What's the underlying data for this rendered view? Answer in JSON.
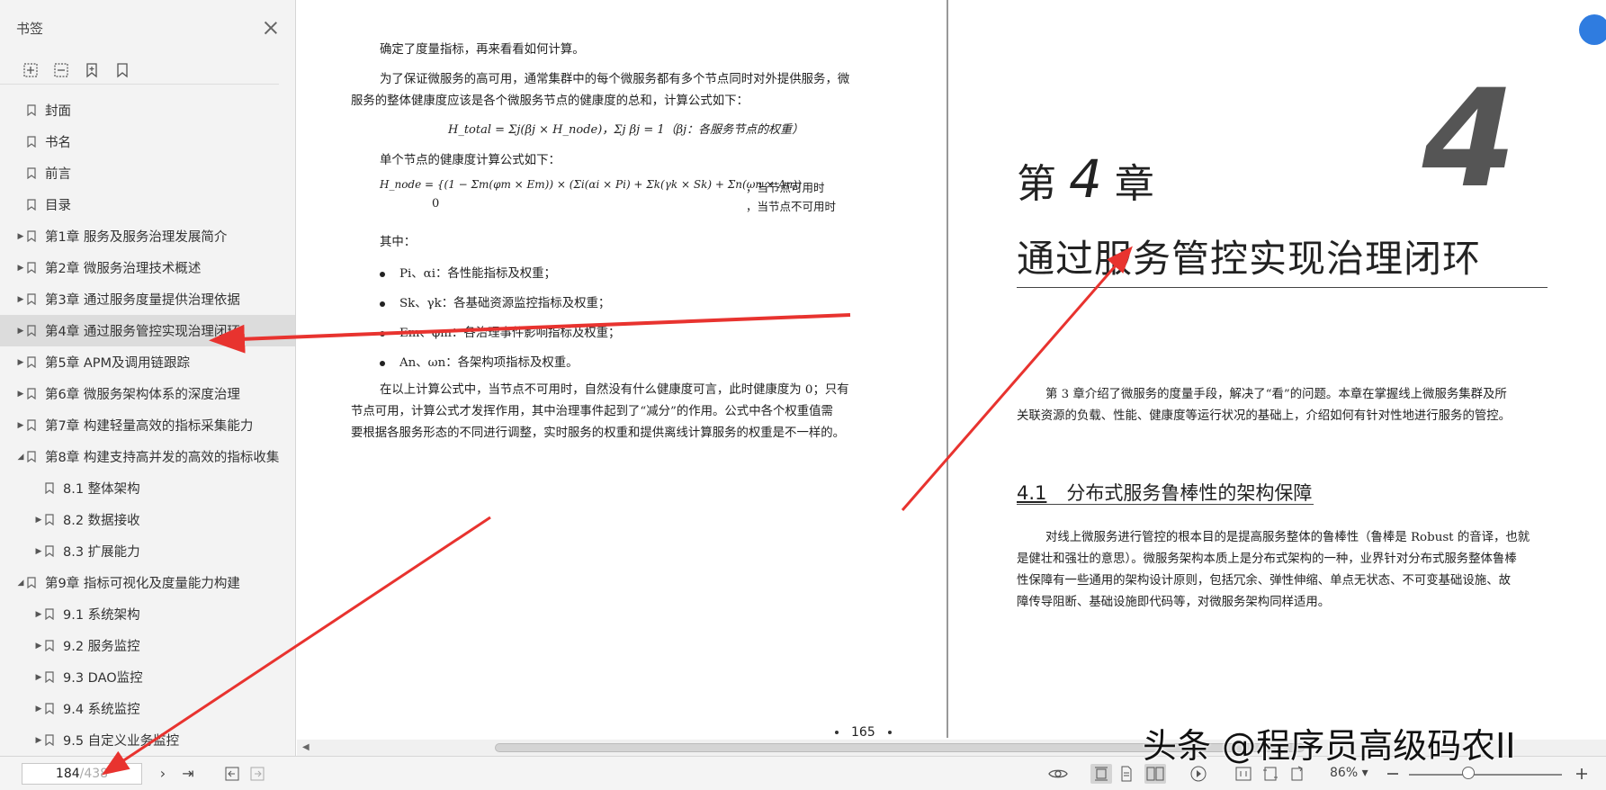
{
  "sidebar": {
    "title": "书签",
    "tools": [
      "expand-all-icon",
      "collapse-all-icon",
      "add-bookmark-icon",
      "bookmark-icon"
    ],
    "items": [
      {
        "label": "封面",
        "level": 0,
        "arrow": "",
        "selected": false
      },
      {
        "label": "书名",
        "level": 0,
        "arrow": "",
        "selected": false
      },
      {
        "label": "前言",
        "level": 0,
        "arrow": "",
        "selected": false
      },
      {
        "label": "目录",
        "level": 0,
        "arrow": "",
        "selected": false
      },
      {
        "label": "第1章 服务及服务治理发展简介",
        "level": 0,
        "arrow": "collapsed",
        "selected": false
      },
      {
        "label": "第2章 微服务治理技术概述",
        "level": 0,
        "arrow": "collapsed",
        "selected": false
      },
      {
        "label": "第3章 通过服务度量提供治理依据",
        "level": 0,
        "arrow": "collapsed",
        "selected": false
      },
      {
        "label": "第4章 通过服务管控实现治理闭环",
        "level": 0,
        "arrow": "collapsed",
        "selected": true
      },
      {
        "label": "第5章 APM及调用链跟踪",
        "level": 0,
        "arrow": "collapsed",
        "selected": false
      },
      {
        "label": "第6章 微服务架构体系的深度治理",
        "level": 0,
        "arrow": "collapsed",
        "selected": false
      },
      {
        "label": "第7章 构建轻量高效的指标采集能力",
        "level": 0,
        "arrow": "collapsed",
        "selected": false
      },
      {
        "label": "第8章 构建支持高并发的高效的指标收集",
        "level": 0,
        "arrow": "expanded",
        "selected": false
      },
      {
        "label": "8.1 整体架构",
        "level": 1,
        "arrow": "",
        "selected": false
      },
      {
        "label": "8.2 数据接收",
        "level": 1,
        "arrow": "collapsed",
        "selected": false
      },
      {
        "label": "8.3 扩展能力",
        "level": 1,
        "arrow": "collapsed",
        "selected": false
      },
      {
        "label": "第9章 指标可视化及度量能力构建",
        "level": 0,
        "arrow": "expanded",
        "selected": false
      },
      {
        "label": "9.1 系统架构",
        "level": 1,
        "arrow": "collapsed",
        "selected": false
      },
      {
        "label": "9.2 服务监控",
        "level": 1,
        "arrow": "collapsed",
        "selected": false
      },
      {
        "label": "9.3 DAO监控",
        "level": 1,
        "arrow": "collapsed",
        "selected": false
      },
      {
        "label": "9.4 系统监控",
        "level": 1,
        "arrow": "collapsed",
        "selected": false
      },
      {
        "label": "9.5 自定义业务监控",
        "level": 1,
        "arrow": "collapsed",
        "selected": false
      }
    ]
  },
  "left_page": {
    "p1": "确定了度量指标，再来看看如何计算。",
    "p2a": "为了保证微服务的高可用，通常集群中的每个微服务都有多个节点同时对外提供服务，微",
    "p2b": "服务的整体健康度应该是各个微服务节点的健康度的总和，计算公式如下：",
    "formula1": "H_total = Σj(βj × H_node)，Σj βj = 1（βj：各服务节点的权重）",
    "p3": "单个节点的健康度计算公式如下：",
    "formula2a": "H_node = {(1 − Σm(φm × Em)) × (Σi(αi × Pi) + Σk(γk × Sk) + Σn(ωn × An))",
    "formula2a_cond": "，当节点可用时",
    "formula2b": "0",
    "formula2b_cond": "，当节点不可用时",
    "p4": "其中：",
    "bullets": [
      "Pi、αi：各性能指标及权重；",
      "Sk、γk：各基础资源监控指标及权重；",
      "Em、φm：各治理事件影响指标及权重；",
      "An、ωn：各架构项指标及权重。"
    ],
    "p5a": "在以上计算公式中，当节点不可用时，自然没有什么健康度可言，此时健康度为 0；只有",
    "p5b": "节点可用，计算公式才发挥作用，其中治理事件起到了“减分”的作用。公式中各个权重值需",
    "p5c": "要根据各服务形态的不同进行调整，实时服务的权重和提供离线计算服务的权重是不一样的。",
    "page_number": "165"
  },
  "right_page": {
    "big_number": "4",
    "chapter_prefix": "第",
    "chapter_num": "4",
    "chapter_suffix": "章",
    "chapter_title": "通过服务管控实现治理闭环",
    "intro_a": "第 3 章介绍了微服务的度量手段，解决了“看”的问题。本章在掌握线上微服务集群及所",
    "intro_b": "关联资源的负载、性能、健康度等运行状况的基础上，介绍如何有针对性地进行服务的管控。",
    "section_num": "4.1",
    "section_title": "分布式服务鲁棒性的架构保障",
    "body_a": "对线上微服务进行管控的根本目的是提高服务整体的鲁棒性（鲁棒是 Robust 的音译，也就",
    "body_b": "是健壮和强壮的意思）。微服务架构本质上是分布式架构的一种，业界针对分布式服务整体鲁棒",
    "body_c": "性保障有一些通用的架构设计原则，包括冗余、弹性伸缩、单点无状态、不可变基础设施、故",
    "body_d": "障传导阻断、基础设施即代码等，对微服务架构同样适用。"
  },
  "statusbar": {
    "page_current": "184",
    "page_total": "/438",
    "zoom": "86%",
    "zoom_level_fraction": 0.39
  },
  "watermark": "头条 @程序员高级码农II",
  "colors": {
    "annotation_arrow": "#e8332f",
    "float_button": "#2f7ce0",
    "sidebar_bg": "#f3f3f3"
  }
}
